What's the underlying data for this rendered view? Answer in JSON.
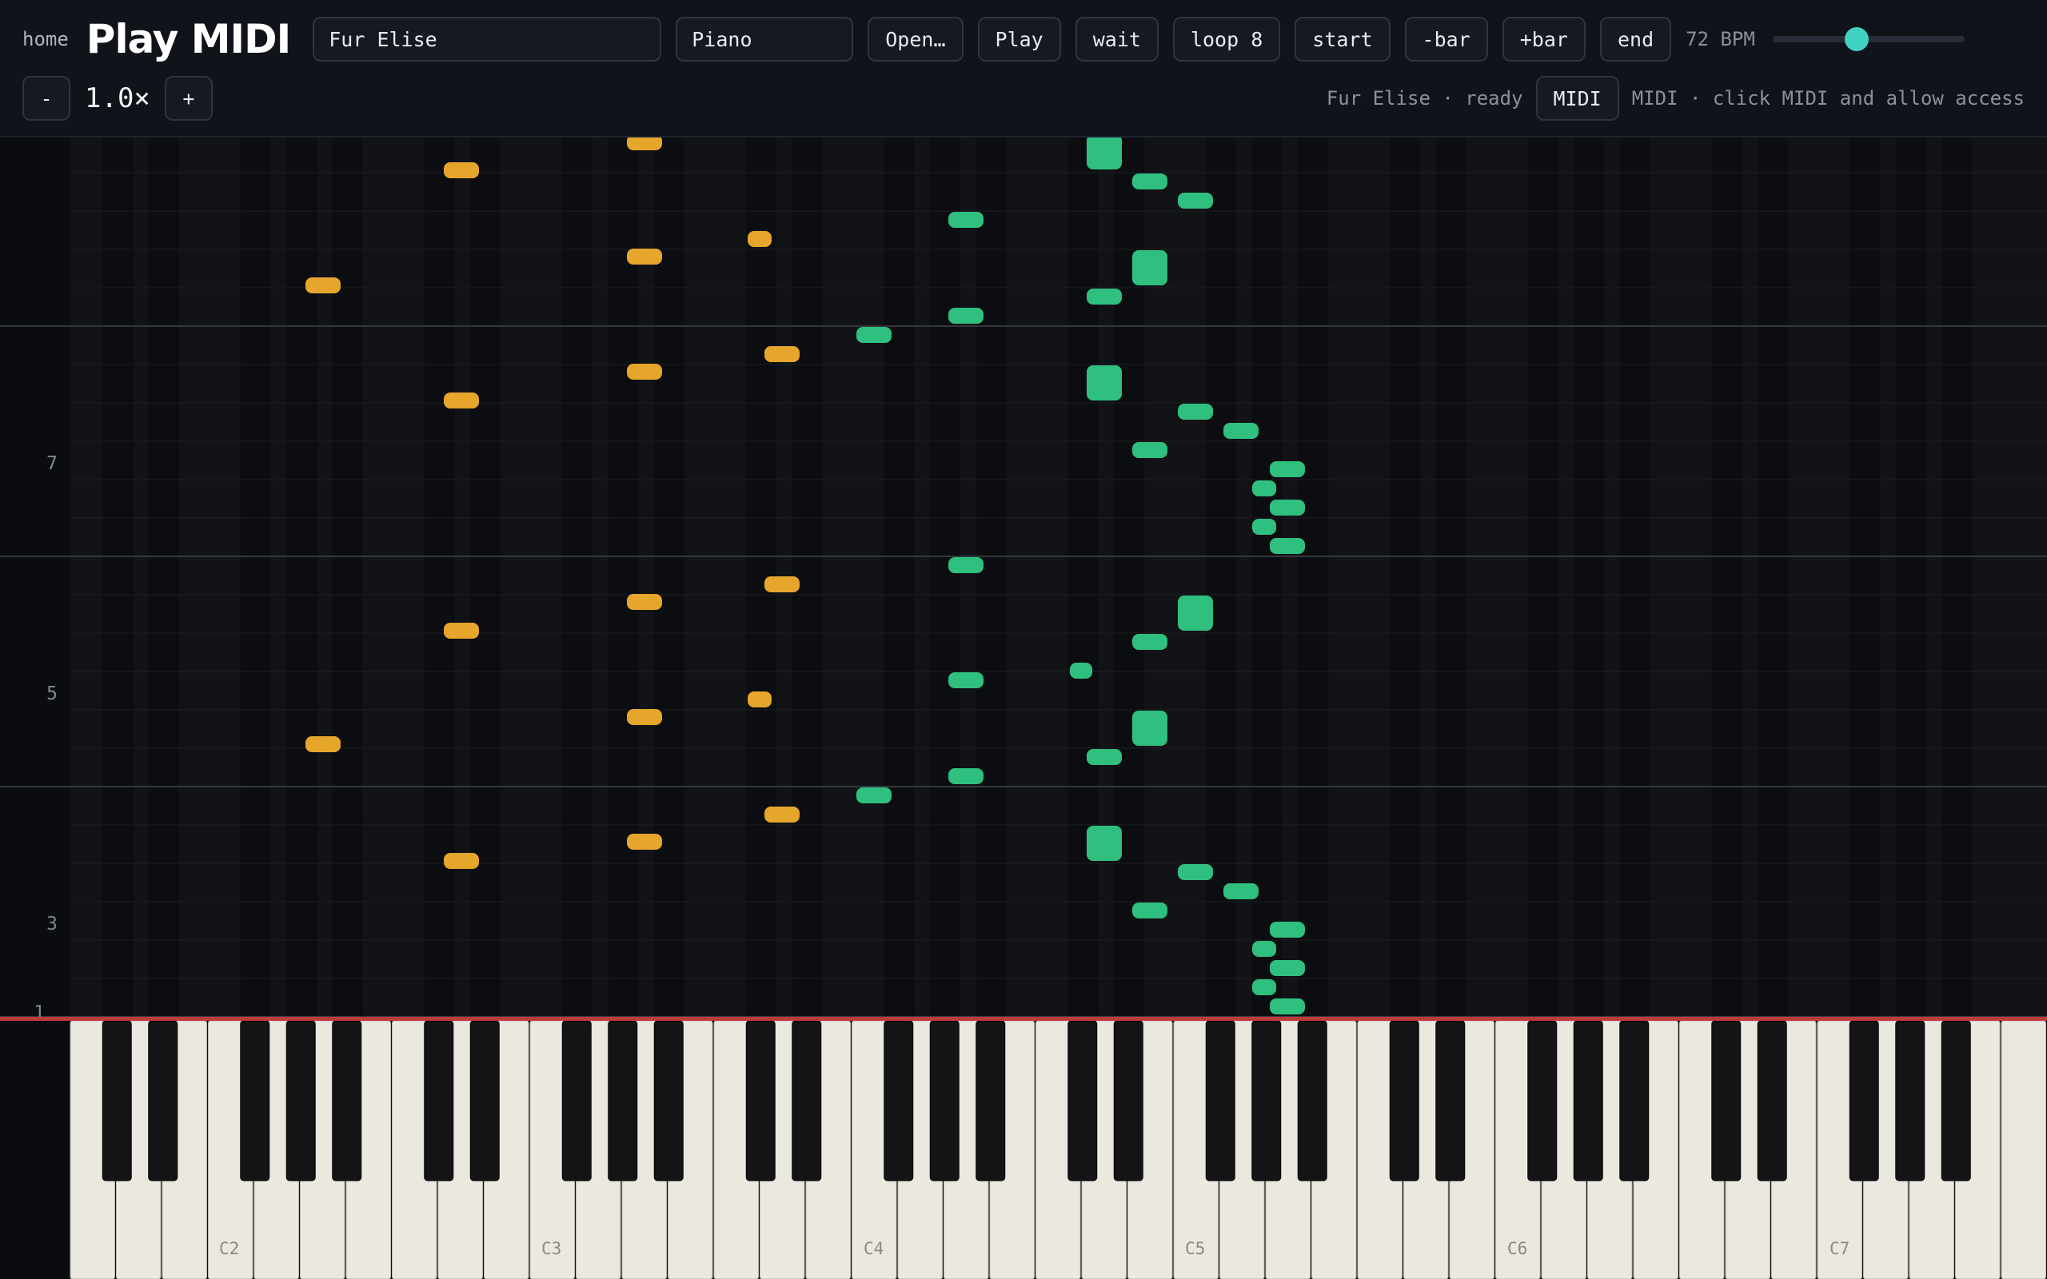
{
  "header": {
    "home_label": "home",
    "logo_text": "Play MIDI",
    "song_value": "Fur Elise",
    "instrument_value": "Piano",
    "buttons": {
      "open": "Open…",
      "play": "Play",
      "wait": "wait",
      "loop": "loop 8",
      "start": "start",
      "prev_bar": "-bar",
      "next_bar": "+bar",
      "end": "end"
    },
    "bpm_label": "72 BPM",
    "tempo_fraction": 0.44
  },
  "subbar": {
    "zoom_minus": "-",
    "zoom_value": "1.0×",
    "zoom_plus": "+",
    "song_status": "Fur Elise · ready",
    "midi_button": "MIDI",
    "midi_status": "MIDI · click MIDI and allow access"
  },
  "roll": {
    "bar_labels": [
      "1",
      "3",
      "5",
      "7"
    ],
    "colors": {
      "left_hand": "#e6a52b",
      "right_hand": "#2fbf7f",
      "playline": "#c13a3a"
    }
  },
  "keyboard": {
    "octave_labels": [
      "C2",
      "C3",
      "C4",
      "C5",
      "C6",
      "C7"
    ]
  }
}
